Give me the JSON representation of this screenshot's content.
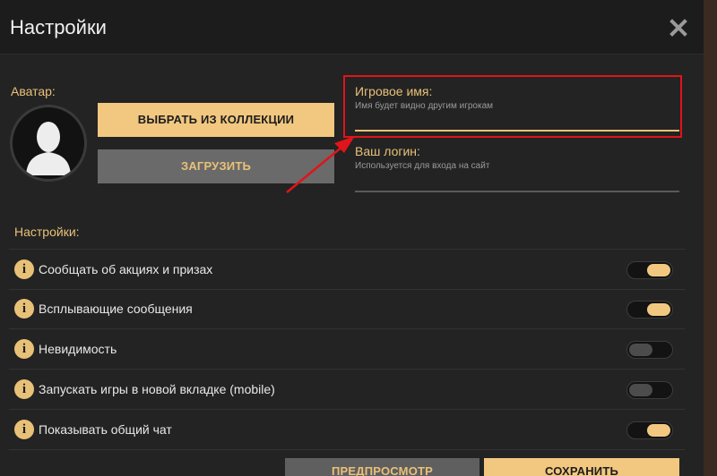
{
  "dialog": {
    "title": "Настройки",
    "close_icon": "close-icon"
  },
  "avatar": {
    "label": "Аватар:",
    "icon": "user-silhouette-icon",
    "choose_button": "ВЫБРАТЬ ИЗ КОЛЛЕКЦИИ",
    "upload_button": "ЗАГРУЗИТЬ"
  },
  "game_name": {
    "label": "Игровое имя:",
    "hint": "Имя будет видно другим игрокам",
    "value": ""
  },
  "login": {
    "label": "Ваш логин:",
    "hint": "Используется для входа на сайт",
    "value": ""
  },
  "settings": {
    "label": "Настройки:",
    "items": [
      {
        "label": "Сообщать об акциях и призах",
        "on": true
      },
      {
        "label": "Всплывающие сообщения",
        "on": true
      },
      {
        "label": "Невидимость",
        "on": false
      },
      {
        "label": "Запускать игры в новой вкладке (mobile)",
        "on": false
      },
      {
        "label": "Показывать общий чат",
        "on": true
      }
    ]
  },
  "footer": {
    "preview_button": "ПРЕДПРОСМОТР",
    "save_button": "СОХРАНИТЬ"
  },
  "colors": {
    "accent": "#f2c880",
    "label_gold": "#e8c178",
    "annotation_red": "#e0141a"
  }
}
